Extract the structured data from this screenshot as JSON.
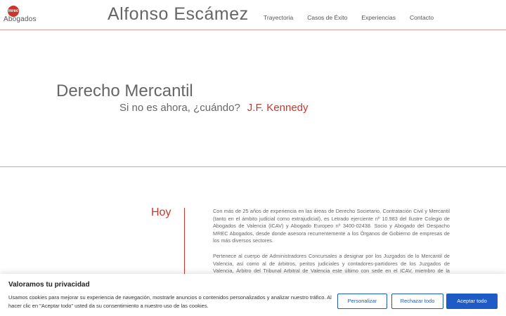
{
  "header": {
    "logo_mark": "mrec",
    "logo_text": "Abogados",
    "site_title": "Alfonso Escámez",
    "nav": [
      "Trayectoria",
      "Casos de Éxito",
      "Experiencias",
      "Contacto"
    ]
  },
  "hero": {
    "title": "Derecho Mercantil",
    "quote": "Si no es ahora, ¿cuándo?",
    "author": "J.F. Kennedy"
  },
  "content": {
    "section_label": "Hoy",
    "paragraph_1": "Con más de 25 años de experiencia en las áreas de Derecho Societario, Contratación Civil y Mercantil (tanto en el ámbito judicial como extrajudicial), es Letrado ejerciente nº 10.983 del Ilustre Colegio de Abogados de Valencia (ICAV) y Abogado Europeo nº 3400-02438. Socio y Abogado del Despacho MREC Abogados, desde donde asesora recurrentemente a los Órganos de Gobierno de empresas de los más diversos sectores.",
    "paragraph_2": "Pertenece al cuerpo de Administradores Concursales a designar por los Juzgados de lo Mercantil de Valencia, así como al de árbitros, peritos judiciales y contadores-partidores de los Juzgados de Valencia, Árbitro del Tribunal Arbitral de Valencia este último con sede en el ICAV, miembro de la Comisión Legal"
  },
  "cookie_banner": {
    "title": "Valoramos tu privacidad",
    "text": "Usamos cookies para mejorar su experiencia de navegación, mostrarle anuncios o contenidos personalizados y analizar nuestro tráfico. Al hacer clic en \"Aceptar todo\" usted da su consentimiento a nuestro uso de las cookies.",
    "btn_customize": "Personalizar",
    "btn_reject": "Rechazar todo",
    "btn_accept": "Aceptar todo"
  },
  "colors": {
    "accent": "#c8372d",
    "button_blue": "#1e5bc6",
    "divider": "#d6a29c"
  }
}
